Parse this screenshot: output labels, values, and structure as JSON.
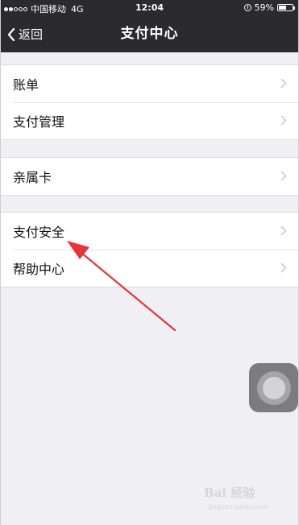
{
  "status_bar": {
    "carrier": "中国移动",
    "network": "4G",
    "time": "12:04",
    "battery": "59%",
    "signal_bars": 2,
    "battery_level": 0.59
  },
  "nav": {
    "back_label": "返回",
    "title": "支付中心"
  },
  "groups": [
    {
      "items": [
        "账单",
        "支付管理"
      ]
    },
    {
      "items": [
        "亲属卡"
      ]
    },
    {
      "items": [
        "支付安全",
        "帮助中心"
      ]
    }
  ],
  "watermark": {
    "text": "Bai 经验",
    "subtext": "jingyan.baidu.com"
  },
  "colors": {
    "bar_bg": "#2b2b2d",
    "page_bg": "#efeff4",
    "arrow": "#e8333a"
  }
}
